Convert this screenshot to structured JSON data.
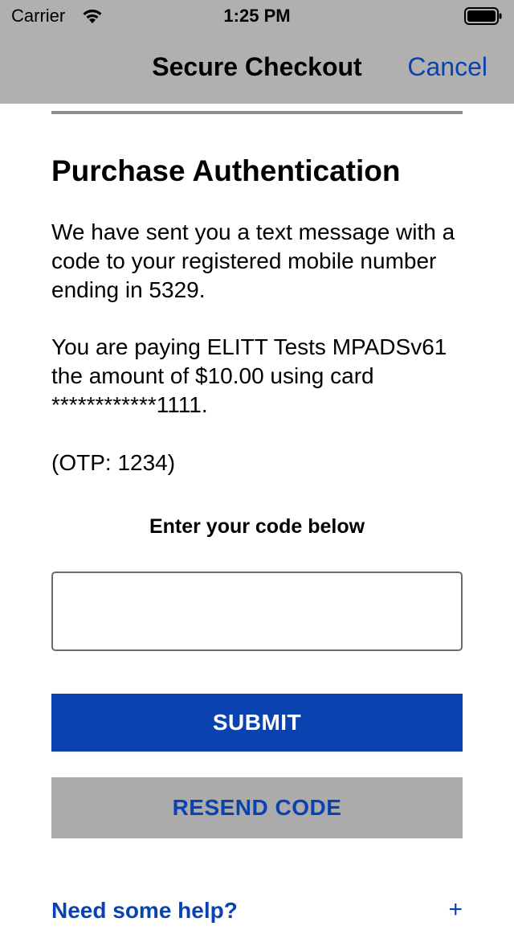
{
  "status_bar": {
    "carrier": "Carrier",
    "time": "1:25 PM",
    "icons": [
      "wifi-icon",
      "battery-icon"
    ]
  },
  "nav": {
    "title": "Secure Checkout",
    "cancel_label": "Cancel"
  },
  "main": {
    "heading": "Purchase Authentication",
    "paragraph_1": "We have sent you a text message with a code to your registered mobile number ending in 5329.",
    "paragraph_2": "You are paying ELITT Tests MPADSv61 the amount of $10.00 using card ************1111.",
    "otp_hint": "(OTP: 1234)",
    "code_label": "Enter your code below",
    "code_input": {
      "value": "",
      "placeholder": ""
    },
    "submit_label": "SUBMIT",
    "resend_label": "RESEND CODE",
    "help_label": "Need some help?",
    "help_expand": "+"
  },
  "colors": {
    "accent": "#0a43b0",
    "bar_background": "#b0b0b0",
    "secondary_button": "#ababab"
  }
}
